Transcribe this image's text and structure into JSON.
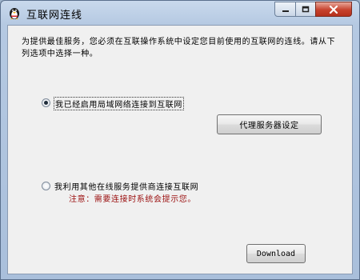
{
  "window": {
    "title": "互联网连线",
    "controls": {
      "minimize": "minimize",
      "maximize": "maximize",
      "close": "close"
    }
  },
  "description": "为提供最佳服务，您必须在互联操作系统中设定您目前使用的互联网的连线。请从下列选项中选择一种。",
  "options": [
    {
      "label": "我已经启用局域网络连接到互联网",
      "selected": true
    },
    {
      "label": "我利用其他在线服务提供商连接互联网",
      "selected": false
    }
  ],
  "buttons": {
    "proxy": "代理服务器设定",
    "download": "Download"
  },
  "note": "注意：需要连接时系统会提示您。",
  "colors": {
    "note": "#9b1010",
    "close": "#c7422d"
  }
}
